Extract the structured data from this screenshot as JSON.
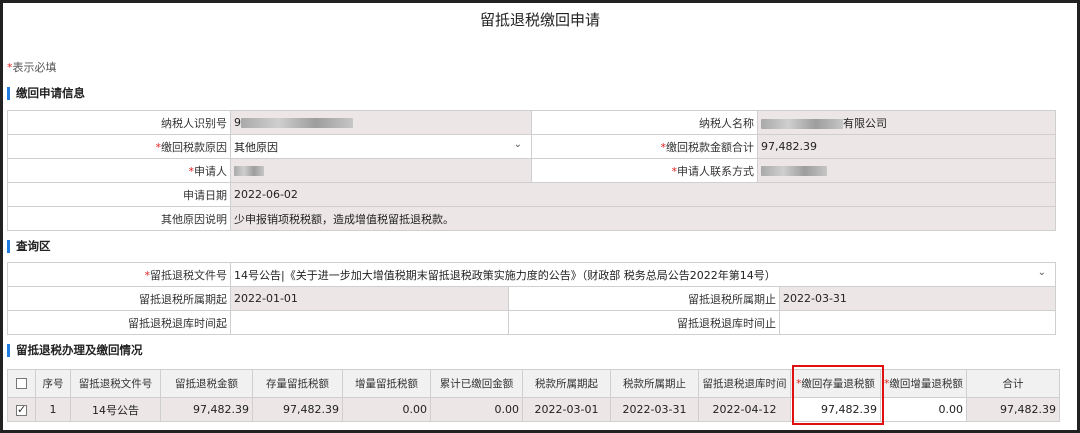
{
  "page_title": "留抵退税缴回申请",
  "required_note": {
    "star": "*",
    "text": "表示必填"
  },
  "sections": {
    "apply_info": "缴回申请信息",
    "query": "查询区",
    "status": "留抵退税办理及缴回情况"
  },
  "apply": {
    "taxpayer_id_label": "纳税人识别号",
    "taxpayer_id_value": "9",
    "taxpayer_name_label": "纳税人名称",
    "taxpayer_name_suffix": "有限公司",
    "reason_label": "缴回税款原因",
    "reason_value": "其他原因",
    "amount_total_label": "缴回税款金额合计",
    "amount_total_value": "97,482.39",
    "applicant_label": "申请人",
    "contact_label": "申请人联系方式",
    "date_label": "申请日期",
    "date_value": "2022-06-02",
    "other_reason_label": "其他原因说明",
    "other_reason_value": "少申报销项税税额，造成增值税留抵退税款。"
  },
  "query": {
    "doc_label": "留抵退税文件号",
    "doc_value": "14号公告|《关于进一步加大增值税期末留抵退税政策实施力度的公告》（财政部 税务总局公告2022年第14号）",
    "period_start_label": "留抵退税所属期起",
    "period_start_value": "2022-01-01",
    "period_end_label": "留抵退税所属期止",
    "period_end_value": "2022-03-31",
    "refund_start_label": "留抵退税退库时间起",
    "refund_end_label": "留抵退税退库时间止"
  },
  "grid": {
    "headers": {
      "seq": "序号",
      "doc": "留抵退税文件号",
      "refund_amount": "留抵退税金额",
      "stock_tax": "存量留抵税额",
      "incr_tax": "增量留抵税额",
      "returned_total": "累计已缴回金额",
      "period_start": "税款所属期起",
      "period_end": "税款所属期止",
      "refund_time": "留抵退税退库时间",
      "return_stock": "缴回存量退税额",
      "return_incr": "缴回增量退税额",
      "total": "合计"
    },
    "row": {
      "seq": "1",
      "doc": "14号公告",
      "refund_amount": "97,482.39",
      "stock_tax": "97,482.39",
      "incr_tax": "0.00",
      "returned_total": "0.00",
      "period_start": "2022-03-01",
      "period_end": "2022-03-31",
      "refund_time": "2022-04-12",
      "return_stock": "97,482.39",
      "return_incr": "0.00",
      "total": "97,482.39"
    }
  },
  "colors": {
    "accent": "#1e7be0",
    "required": "#e02020",
    "highlight": "#e01010",
    "value_bg": "#ece6e6"
  }
}
